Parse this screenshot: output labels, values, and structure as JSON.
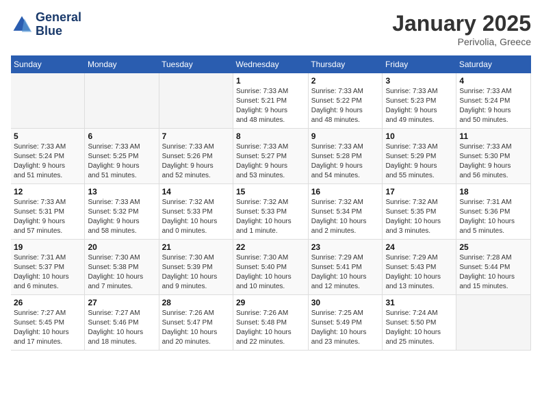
{
  "header": {
    "logo_line1": "General",
    "logo_line2": "Blue",
    "month": "January 2025",
    "location": "Perivolia, Greece"
  },
  "weekdays": [
    "Sunday",
    "Monday",
    "Tuesday",
    "Wednesday",
    "Thursday",
    "Friday",
    "Saturday"
  ],
  "weeks": [
    [
      {
        "day": "",
        "info": ""
      },
      {
        "day": "",
        "info": ""
      },
      {
        "day": "",
        "info": ""
      },
      {
        "day": "1",
        "info": "Sunrise: 7:33 AM\nSunset: 5:21 PM\nDaylight: 9 hours\nand 48 minutes."
      },
      {
        "day": "2",
        "info": "Sunrise: 7:33 AM\nSunset: 5:22 PM\nDaylight: 9 hours\nand 48 minutes."
      },
      {
        "day": "3",
        "info": "Sunrise: 7:33 AM\nSunset: 5:23 PM\nDaylight: 9 hours\nand 49 minutes."
      },
      {
        "day": "4",
        "info": "Sunrise: 7:33 AM\nSunset: 5:24 PM\nDaylight: 9 hours\nand 50 minutes."
      }
    ],
    [
      {
        "day": "5",
        "info": "Sunrise: 7:33 AM\nSunset: 5:24 PM\nDaylight: 9 hours\nand 51 minutes."
      },
      {
        "day": "6",
        "info": "Sunrise: 7:33 AM\nSunset: 5:25 PM\nDaylight: 9 hours\nand 51 minutes."
      },
      {
        "day": "7",
        "info": "Sunrise: 7:33 AM\nSunset: 5:26 PM\nDaylight: 9 hours\nand 52 minutes."
      },
      {
        "day": "8",
        "info": "Sunrise: 7:33 AM\nSunset: 5:27 PM\nDaylight: 9 hours\nand 53 minutes."
      },
      {
        "day": "9",
        "info": "Sunrise: 7:33 AM\nSunset: 5:28 PM\nDaylight: 9 hours\nand 54 minutes."
      },
      {
        "day": "10",
        "info": "Sunrise: 7:33 AM\nSunset: 5:29 PM\nDaylight: 9 hours\nand 55 minutes."
      },
      {
        "day": "11",
        "info": "Sunrise: 7:33 AM\nSunset: 5:30 PM\nDaylight: 9 hours\nand 56 minutes."
      }
    ],
    [
      {
        "day": "12",
        "info": "Sunrise: 7:33 AM\nSunset: 5:31 PM\nDaylight: 9 hours\nand 57 minutes."
      },
      {
        "day": "13",
        "info": "Sunrise: 7:33 AM\nSunset: 5:32 PM\nDaylight: 9 hours\nand 58 minutes."
      },
      {
        "day": "14",
        "info": "Sunrise: 7:32 AM\nSunset: 5:33 PM\nDaylight: 10 hours\nand 0 minutes."
      },
      {
        "day": "15",
        "info": "Sunrise: 7:32 AM\nSunset: 5:33 PM\nDaylight: 10 hours\nand 1 minute."
      },
      {
        "day": "16",
        "info": "Sunrise: 7:32 AM\nSunset: 5:34 PM\nDaylight: 10 hours\nand 2 minutes."
      },
      {
        "day": "17",
        "info": "Sunrise: 7:32 AM\nSunset: 5:35 PM\nDaylight: 10 hours\nand 3 minutes."
      },
      {
        "day": "18",
        "info": "Sunrise: 7:31 AM\nSunset: 5:36 PM\nDaylight: 10 hours\nand 5 minutes."
      }
    ],
    [
      {
        "day": "19",
        "info": "Sunrise: 7:31 AM\nSunset: 5:37 PM\nDaylight: 10 hours\nand 6 minutes."
      },
      {
        "day": "20",
        "info": "Sunrise: 7:30 AM\nSunset: 5:38 PM\nDaylight: 10 hours\nand 7 minutes."
      },
      {
        "day": "21",
        "info": "Sunrise: 7:30 AM\nSunset: 5:39 PM\nDaylight: 10 hours\nand 9 minutes."
      },
      {
        "day": "22",
        "info": "Sunrise: 7:30 AM\nSunset: 5:40 PM\nDaylight: 10 hours\nand 10 minutes."
      },
      {
        "day": "23",
        "info": "Sunrise: 7:29 AM\nSunset: 5:41 PM\nDaylight: 10 hours\nand 12 minutes."
      },
      {
        "day": "24",
        "info": "Sunrise: 7:29 AM\nSunset: 5:43 PM\nDaylight: 10 hours\nand 13 minutes."
      },
      {
        "day": "25",
        "info": "Sunrise: 7:28 AM\nSunset: 5:44 PM\nDaylight: 10 hours\nand 15 minutes."
      }
    ],
    [
      {
        "day": "26",
        "info": "Sunrise: 7:27 AM\nSunset: 5:45 PM\nDaylight: 10 hours\nand 17 minutes."
      },
      {
        "day": "27",
        "info": "Sunrise: 7:27 AM\nSunset: 5:46 PM\nDaylight: 10 hours\nand 18 minutes."
      },
      {
        "day": "28",
        "info": "Sunrise: 7:26 AM\nSunset: 5:47 PM\nDaylight: 10 hours\nand 20 minutes."
      },
      {
        "day": "29",
        "info": "Sunrise: 7:26 AM\nSunset: 5:48 PM\nDaylight: 10 hours\nand 22 minutes."
      },
      {
        "day": "30",
        "info": "Sunrise: 7:25 AM\nSunset: 5:49 PM\nDaylight: 10 hours\nand 23 minutes."
      },
      {
        "day": "31",
        "info": "Sunrise: 7:24 AM\nSunset: 5:50 PM\nDaylight: 10 hours\nand 25 minutes."
      },
      {
        "day": "",
        "info": ""
      }
    ]
  ]
}
